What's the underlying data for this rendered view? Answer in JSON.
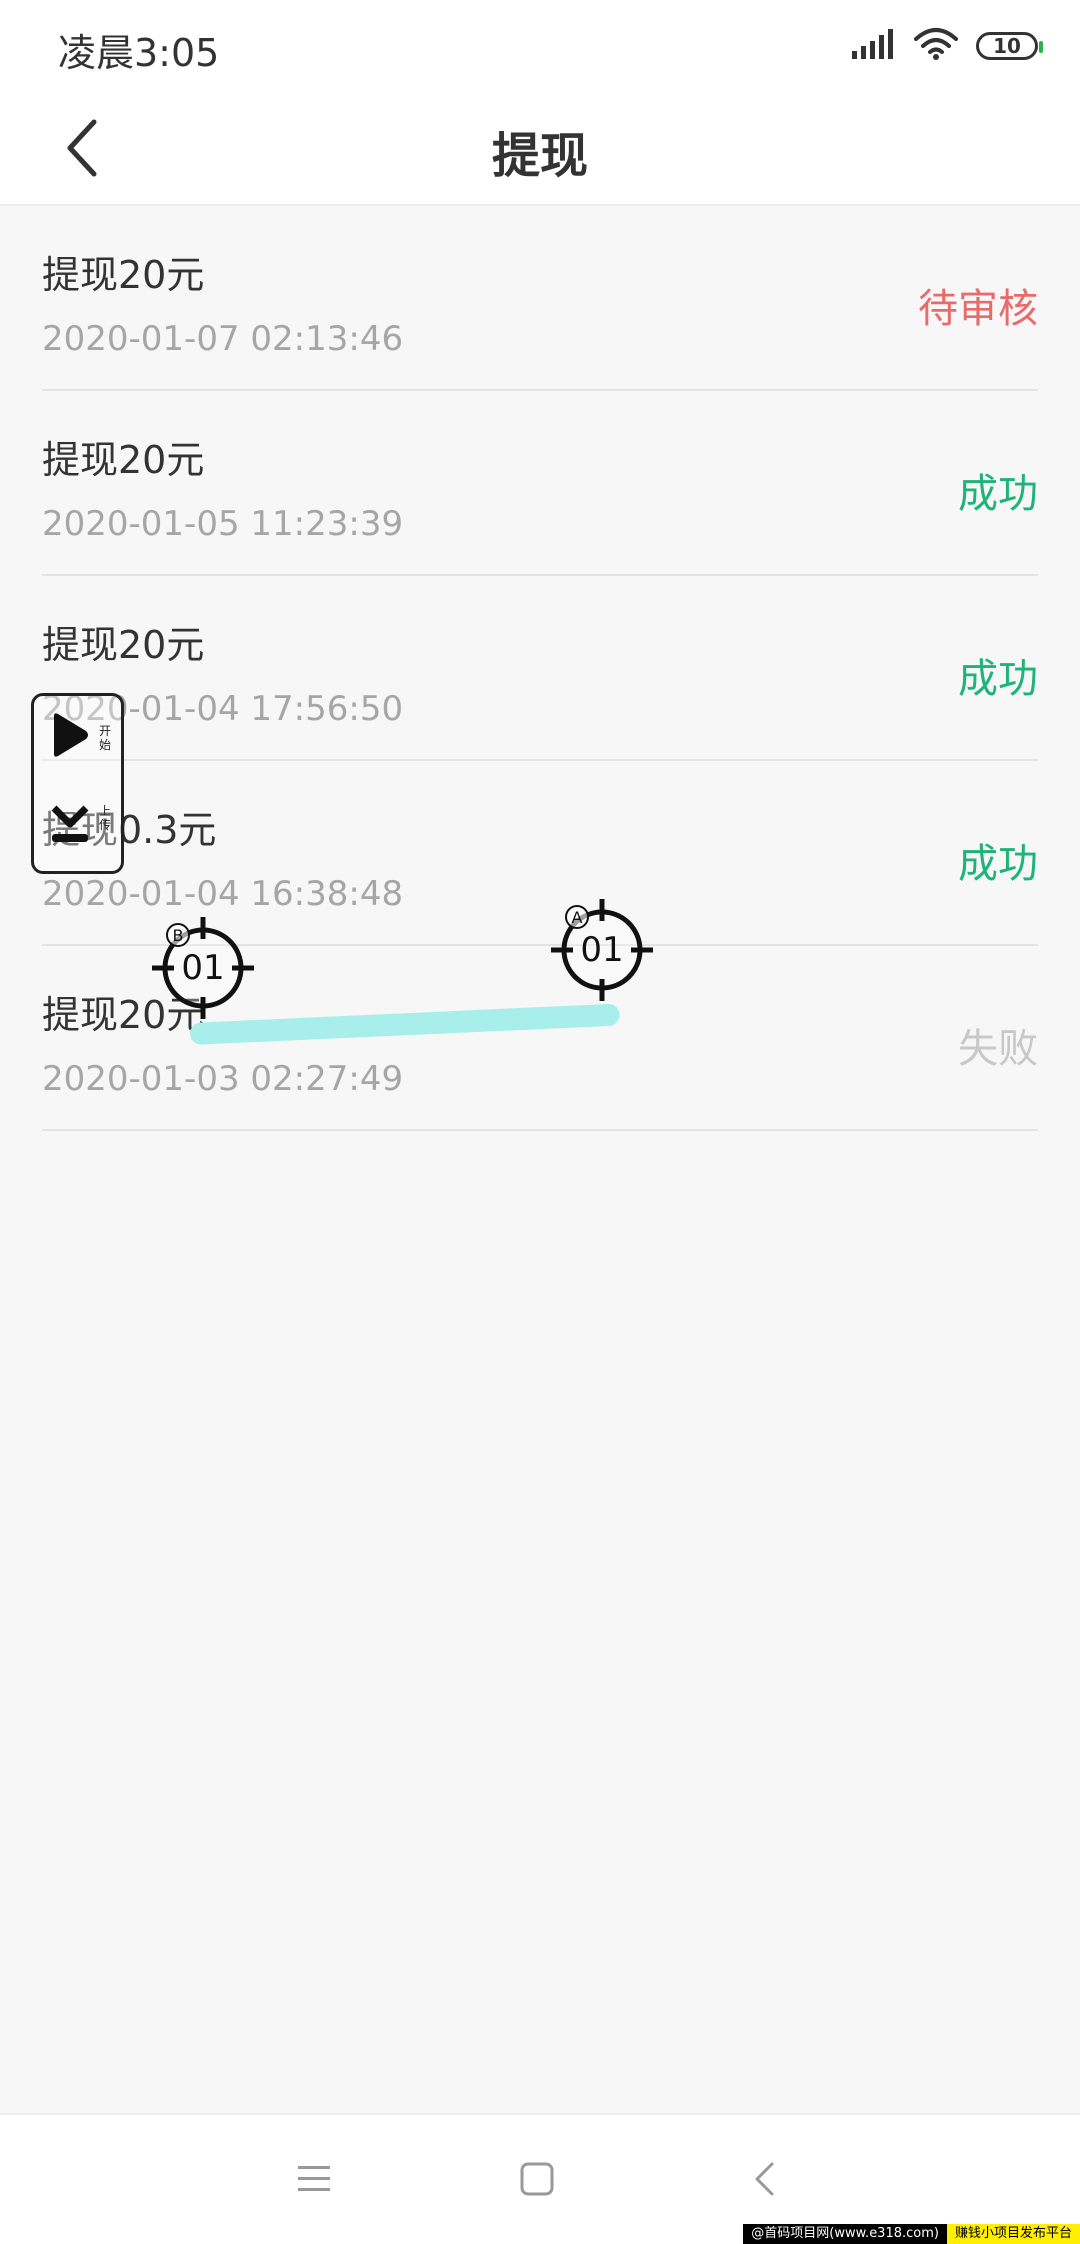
{
  "status_bar": {
    "time": "凌晨3:05",
    "battery": "10"
  },
  "header": {
    "title": "提现"
  },
  "records": [
    {
      "title": "提现20元",
      "time": "2020-01-07 02:13:46",
      "status": "待审核",
      "status_color": "#e86b6b"
    },
    {
      "title": "提现20元",
      "time": "2020-01-05 11:23:39",
      "status": "成功",
      "status_color": "#1fb37a"
    },
    {
      "title": "提现20元",
      "time": "2020-01-04 17:56:50",
      "status": "成功",
      "status_color": "#1fb37a"
    },
    {
      "title": "提现0.3元",
      "time": "2020-01-04 16:38:48",
      "status": "成功",
      "status_color": "#1fb37a"
    },
    {
      "title": "提现20元",
      "time": "2020-01-03 02:27:49",
      "status": "失败",
      "status_color": "#c8c8c8"
    }
  ],
  "float_panel": {
    "start_label": "开始",
    "second_label": "上传"
  },
  "markers": {
    "a": {
      "letter": "A",
      "text": "01"
    },
    "b": {
      "letter": "B",
      "text": "01"
    }
  },
  "watermark": {
    "left": "@首码项目网(www.e318.com)",
    "right": "赚钱小项目发布平台"
  }
}
